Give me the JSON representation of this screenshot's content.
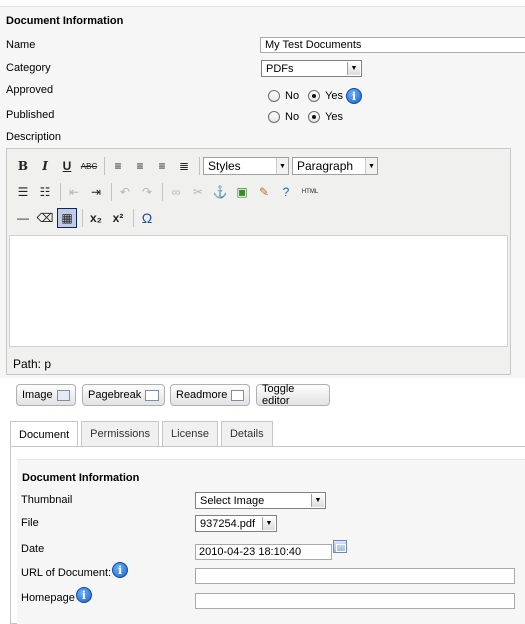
{
  "form": {
    "section_title": "Document Information",
    "name_label": "Name",
    "name_value": "My Test Documents",
    "category_label": "Category",
    "category_value": "PDFs",
    "approved_label": "Approved",
    "published_label": "Published",
    "no_label": "No",
    "yes_label": "Yes",
    "approved_value": "Yes",
    "published_value": "Yes",
    "description_label": "Description"
  },
  "editor": {
    "styles_select": "Styles",
    "format_select": "Paragraph",
    "path_label": "Path: p",
    "toolbar_row1": [
      "B",
      "I",
      "U",
      "ABC"
    ],
    "html_label": "HTML"
  },
  "editor_buttons": {
    "image": "Image",
    "pagebreak": "Pagebreak",
    "readmore": "Readmore",
    "toggle": "Toggle editor"
  },
  "tabs": [
    "Document",
    "Permissions",
    "License",
    "Details"
  ],
  "active_tab": "Document",
  "document_tab": {
    "section_title": "Document Information",
    "thumbnail_label": "Thumbnail",
    "thumbnail_value": "Select Image",
    "file_label": "File",
    "file_value": "937254.pdf",
    "date_label": "Date",
    "date_value": "2010-04-23 18:10:40",
    "url_label": "URL of Document:",
    "url_value": "",
    "homepage_label": "Homepage",
    "homepage_value": ""
  },
  "icons": {
    "info": "info-icon",
    "calendar": "calendar-icon"
  }
}
